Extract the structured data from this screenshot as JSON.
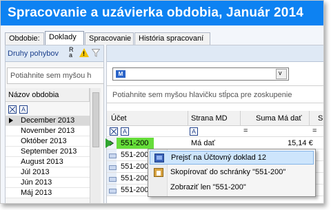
{
  "window": {
    "title": "Spracovanie a uzávierka obdobia, Január 2014"
  },
  "tabs": [
    {
      "label": "Obdobie:"
    },
    {
      "label": "Doklady"
    },
    {
      "label": "Spracovanie"
    },
    {
      "label": "História spracovaní"
    }
  ],
  "left_pane": {
    "toolbar_label": "Druhy pohybov",
    "ra_label": "R\na",
    "warn_symbol": "!",
    "group_hint": "Potiahnite sem myšou h",
    "column_header": "Názov obdobia",
    "filter_symbol": "A",
    "periods": [
      "December 2013",
      "November 2013",
      "Október 2013",
      "September 2013",
      "August 2013",
      "Júl 2013",
      "Jún 2013",
      "Máj 2013"
    ]
  },
  "right_pane": {
    "combo_icon_text": "M",
    "combo_arrow": "v",
    "group_hint": "Potiahnite sem myšou hlavičku stĺpca pre zoskupenie",
    "columns": [
      "Účet",
      "Strana MD",
      "Suma Má dať",
      "S"
    ],
    "filter_row": {
      "strana_filter": "A",
      "eq_symbol": "="
    },
    "rows": [
      {
        "account": "551-200",
        "side": "Má dať",
        "amount": "15,14 €"
      },
      {
        "account": "551-200",
        "side": "",
        "amount": ""
      },
      {
        "account": "551-200",
        "side": "",
        "amount": ""
      },
      {
        "account": "551-200",
        "side": "",
        "amount": ""
      },
      {
        "account": "551-200",
        "side": "",
        "amount": ""
      }
    ]
  },
  "context_menu": {
    "items": [
      {
        "label": "Prejsť na Účtovný doklad 12",
        "icon": "document-book-icon"
      },
      {
        "label": "Skopírovať do schránky \"551-200\"",
        "icon": "clipboard-icon"
      },
      {
        "label": "Zobraziť len \"551-200\"",
        "icon": ""
      }
    ]
  },
  "colors": {
    "title_bar": "#0d82f2",
    "highlight_cell": "#66dd3a",
    "menu_hover": "#cde5fc"
  }
}
